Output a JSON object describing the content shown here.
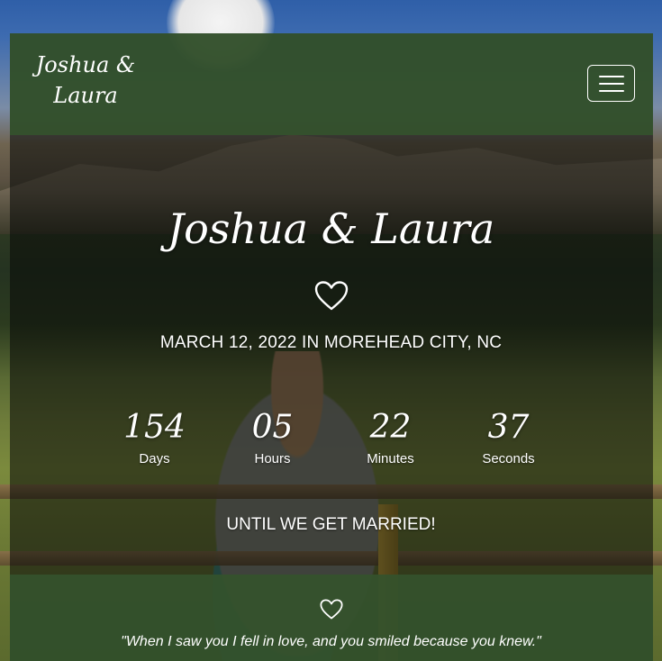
{
  "brand": {
    "line1": "Joshua &",
    "line2": "Laura"
  },
  "hero": {
    "title": "Joshua & Laura",
    "event": "MARCH 12, 2022 IN MOREHEAD CITY, NC",
    "until": "UNTIL WE GET MARRIED!"
  },
  "countdown": [
    {
      "value": "154",
      "label": "Days"
    },
    {
      "value": "05",
      "label": "Hours"
    },
    {
      "value": "22",
      "label": "Minutes"
    },
    {
      "value": "37",
      "label": "Seconds"
    }
  ],
  "quote": {
    "text": "\"When I saw you I fell in love, and you smiled because you knew.\""
  },
  "colors": {
    "band_green": "#34522c",
    "text": "#ffffff"
  },
  "icons": {
    "menu": "hamburger-icon",
    "heart": "heart-outline-icon"
  }
}
